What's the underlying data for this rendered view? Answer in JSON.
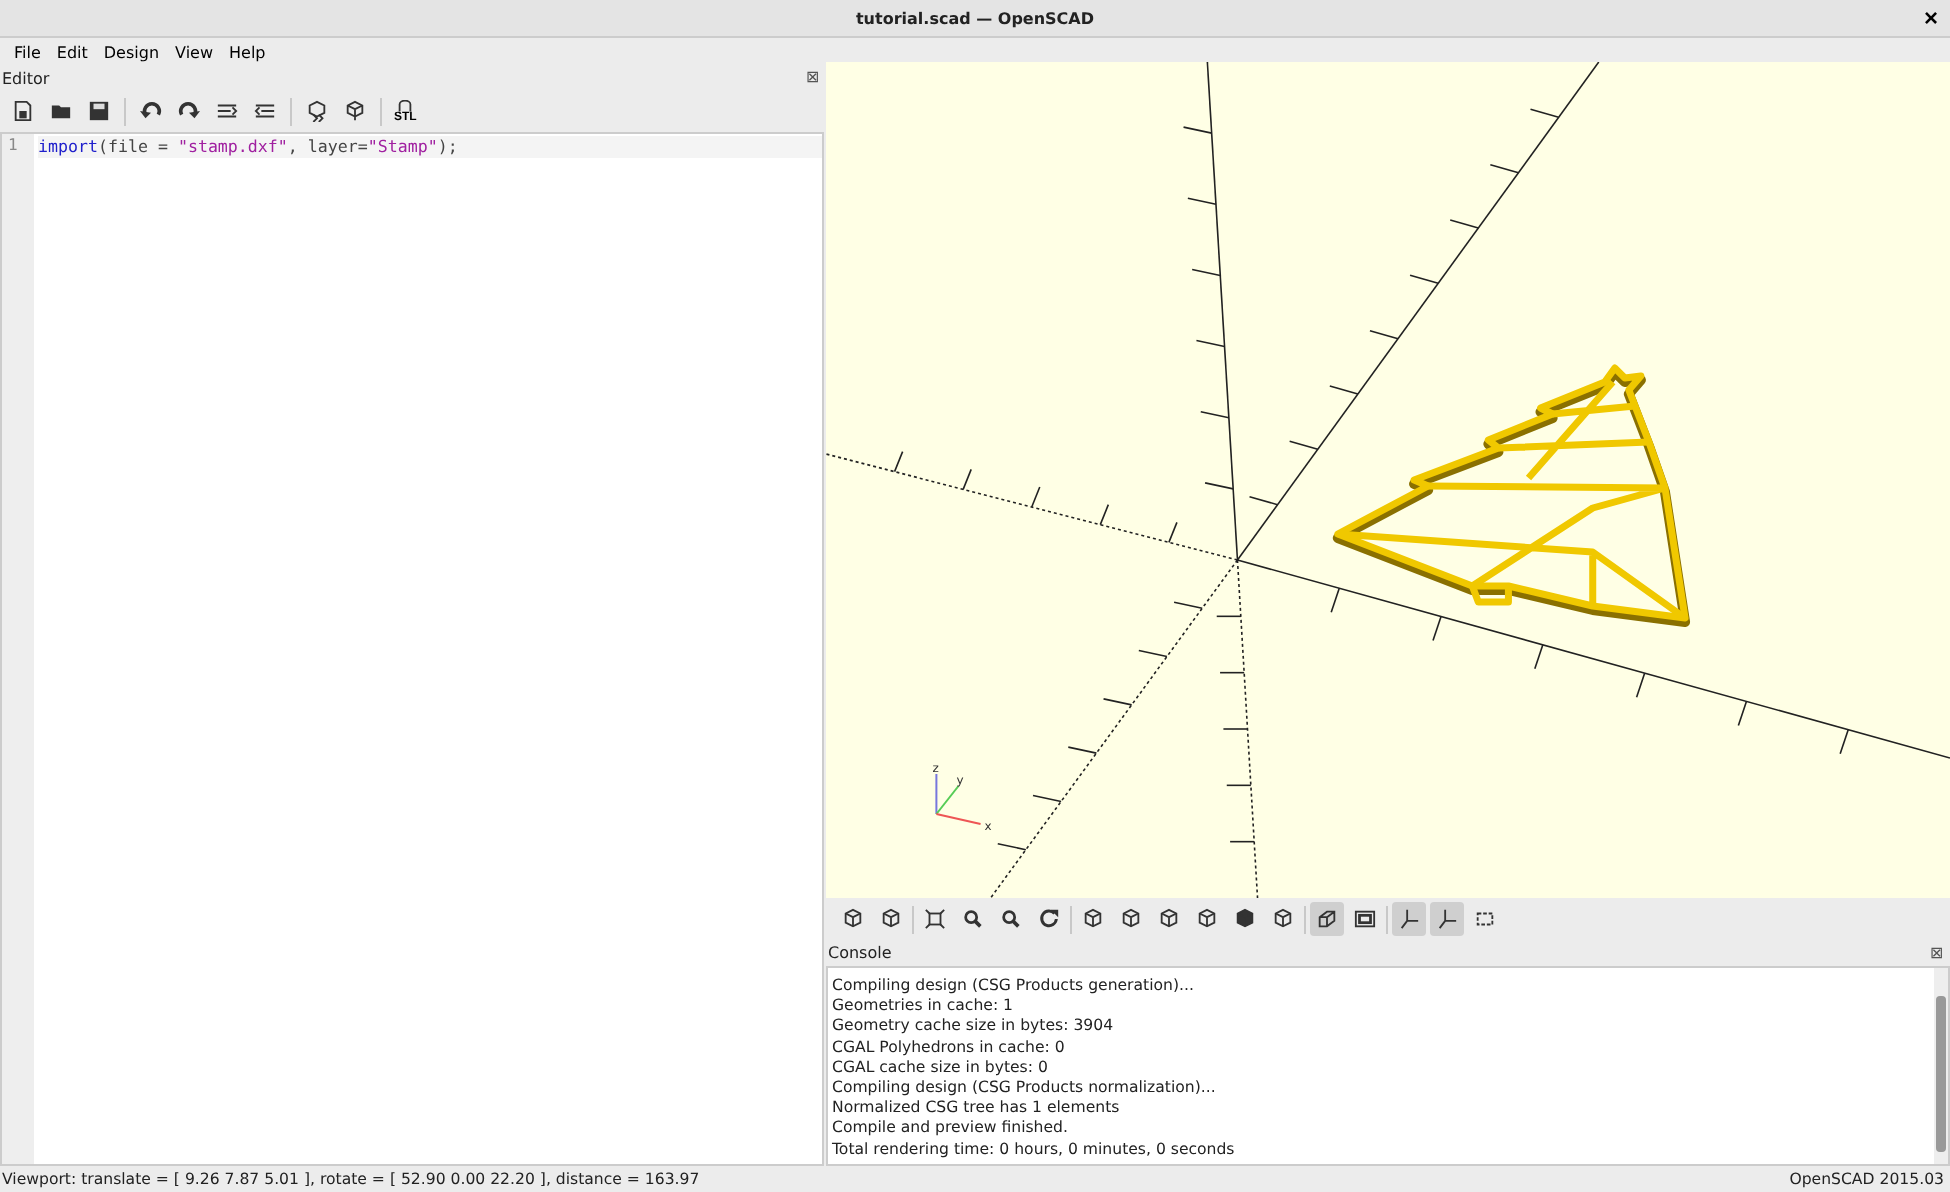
{
  "window": {
    "title": "tutorial.scad — OpenSCAD",
    "close": "×"
  },
  "menu": [
    {
      "label": "File"
    },
    {
      "label": "Edit"
    },
    {
      "label": "Design"
    },
    {
      "label": "View"
    },
    {
      "label": "Help"
    }
  ],
  "editor": {
    "title": "Editor",
    "close": "⊠",
    "export_label": "STL",
    "code_lines": [
      {
        "number": "1",
        "tokens": [
          {
            "kind": "keyword",
            "text": "import"
          },
          {
            "kind": "plain",
            "text": "(file = "
          },
          {
            "kind": "string",
            "text": "\"stamp.dxf\""
          },
          {
            "kind": "plain",
            "text": ", layer="
          },
          {
            "kind": "string",
            "text": "\"Stamp\""
          },
          {
            "kind": "plain",
            "text": ");"
          }
        ]
      }
    ]
  },
  "viewport": {
    "gizmo_labels": [
      "z",
      "y",
      "x"
    ],
    "toolbar": [
      {
        "on": false
      },
      {
        "on": false
      },
      {
        "on": false
      },
      {
        "on": false
      },
      {
        "on": false
      },
      {
        "on": false
      },
      {
        "on": false
      },
      {
        "on": false
      },
      {
        "on": false
      },
      {
        "on": false
      },
      {
        "on": false
      },
      {
        "on": false
      },
      {
        "on": true
      },
      {
        "on": false
      },
      {
        "on": true
      },
      {
        "on": true
      },
      {
        "on": false
      }
    ]
  },
  "console": {
    "title": "Console",
    "close": "⊠",
    "lines": [
      "Compiling design (CSG Products generation)...",
      "Geometries in cache: 1",
      "Geometry cache size in bytes: 3904",
      "CGAL Polyhedrons in cache: 0",
      "CGAL cache size in bytes: 0",
      "Compiling design (CSG Products normalization)...",
      "Normalized CSG tree has 1 elements",
      "Compile and preview finished.",
      "Total rendering time: 0 hours, 0 minutes, 0 seconds"
    ]
  },
  "status_bar": {
    "viewport": "Viewport: translate = [ 9.26 7.87 5.01 ], rotate = [ 52.90 0.00 22.20 ], distance = 163.97",
    "version": "OpenSCAD 2015.03"
  }
}
